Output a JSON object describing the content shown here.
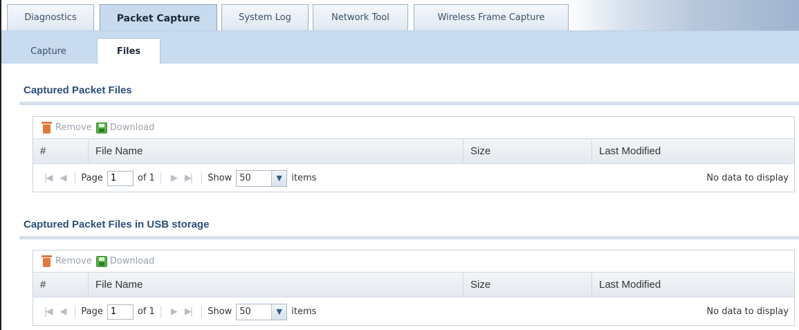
{
  "top_tabs": [
    {
      "label": "Diagnostics"
    },
    {
      "label": "Packet Capture"
    },
    {
      "label": "System Log"
    },
    {
      "label": "Network Tool"
    },
    {
      "label": "Wireless Frame Capture"
    }
  ],
  "sub_tabs": [
    {
      "label": "Capture"
    },
    {
      "label": "Files"
    }
  ],
  "sections": [
    {
      "title": "Captured Packet Files",
      "toolbar": {
        "remove_label": "Remove",
        "download_label": "Download"
      },
      "columns": [
        "#",
        "File Name",
        "Size",
        "Last Modified"
      ],
      "pager": {
        "page_label": "Page",
        "page_value": "1",
        "of_label": "of 1",
        "show_label": "Show",
        "show_value": "50",
        "items_label": "items",
        "empty_text": "No data to display"
      }
    },
    {
      "title": "Captured Packet Files in USB storage",
      "toolbar": {
        "remove_label": "Remove",
        "download_label": "Download"
      },
      "columns": [
        "#",
        "File Name",
        "Size",
        "Last Modified"
      ],
      "pager": {
        "page_label": "Page",
        "page_value": "1",
        "of_label": "of 1",
        "show_label": "Show",
        "show_value": "50",
        "items_label": "items",
        "empty_text": "No data to display"
      }
    }
  ]
}
